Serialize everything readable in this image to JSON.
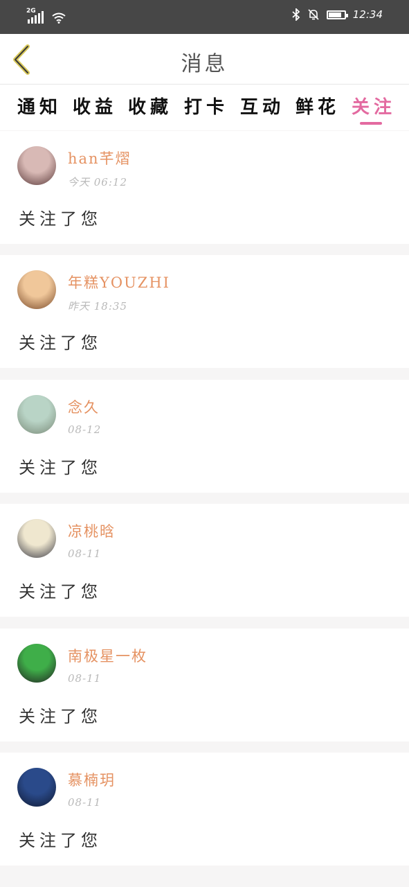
{
  "status_bar": {
    "network": "2G",
    "time": "12:34",
    "battery_level": 0.9,
    "icons": [
      "signal-icon",
      "wifi-icon",
      "bluetooth-icon",
      "mute-bell-icon",
      "battery-icon"
    ]
  },
  "header": {
    "title": "消息",
    "back_icon": "chevron-left-icon"
  },
  "tabs": [
    {
      "label": "通知",
      "active": false
    },
    {
      "label": "收益",
      "active": false
    },
    {
      "label": "收藏",
      "active": false
    },
    {
      "label": "打卡",
      "active": false
    },
    {
      "label": "互动",
      "active": false
    },
    {
      "label": "鲜花",
      "active": false
    },
    {
      "label": "关注",
      "active": true
    }
  ],
  "messages": [
    {
      "name": "han芊熠",
      "time": "今天 06:12",
      "action": "关注了您",
      "avatar_colors": [
        "#d8b9b5",
        "#5b3a3a"
      ]
    },
    {
      "name": "年糕YOUZHI",
      "time": "昨天 18:35",
      "action": "关注了您",
      "avatar_colors": [
        "#f0c79a",
        "#7a4a2a"
      ]
    },
    {
      "name": "念久",
      "time": "08-12",
      "action": "关注了您",
      "avatar_colors": [
        "#b9d4c6",
        "#7a8a78"
      ]
    },
    {
      "name": "凉桃晗",
      "time": "08-11",
      "action": "关注了您",
      "avatar_colors": [
        "#efe7cf",
        "#3c3c46"
      ]
    },
    {
      "name": "南极星一枚",
      "time": "08-11",
      "action": "关注了您",
      "avatar_colors": [
        "#3fae49",
        "#222222"
      ]
    },
    {
      "name": "慕楠玥",
      "time": "08-11",
      "action": "关注了您",
      "avatar_colors": [
        "#2a4a8a",
        "#101a33"
      ]
    }
  ],
  "colors": {
    "accent": "#e36aa0",
    "username": "#e59262",
    "time": "#b9b9b9",
    "statusbar": "#474747"
  }
}
